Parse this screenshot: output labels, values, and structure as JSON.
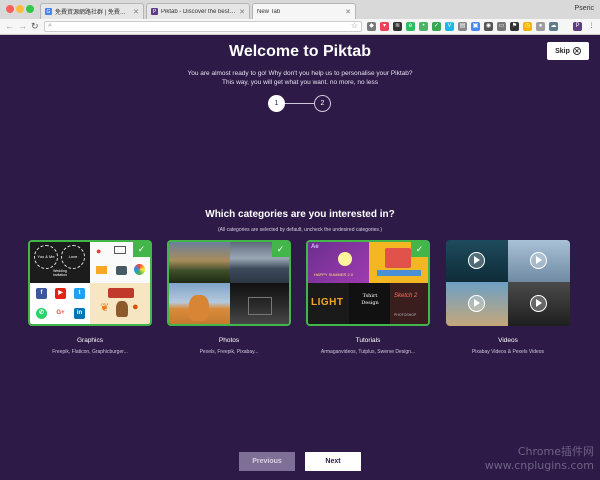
{
  "browser": {
    "tabs": [
      {
        "label": "免費資源網路社群 | 免費資源指",
        "favicon": "G",
        "active": false
      },
      {
        "label": "Piktab - Discover the best gra",
        "favicon": "P",
        "active": false
      },
      {
        "label": "New Tab",
        "favicon": "",
        "active": true
      }
    ],
    "user_name": "Pseric",
    "omnibox": {
      "value": "",
      "placeholder": ""
    },
    "extension_icons": [
      "shield-icon",
      "pocket-icon",
      "layers-icon",
      "evernote-icon",
      "pushbullet-icon",
      "check-icon",
      "vimeo-icon",
      "stack-icon",
      "puzzle-icon",
      "ghost-icon",
      "cast-icon",
      "flag-icon",
      "clock-icon",
      "globe-icon",
      "piktab-icon",
      "menu-icon"
    ]
  },
  "page": {
    "title": "Welcome to Piktab",
    "intro_line1": "You are almost ready to go! Why don't you help us to personalise your Piktab?",
    "intro_line2": "This way, you will get what you want. no more, no less",
    "skip_label": "Skip",
    "steps": [
      "1",
      "2"
    ],
    "question": "Which categories are you interested in?",
    "note": "(All categories are selected by default, uncheck the undesired categories.)",
    "categories": [
      {
        "title": "Graphics",
        "sources": "Freepik, Flaticon, Graphicburger...",
        "selected": true
      },
      {
        "title": "Photos",
        "sources": "Pexels, Freepik, Pixabay...",
        "selected": true
      },
      {
        "title": "Tutorials",
        "sources": "Armaganvideos, Tutplus, Swerve Design...",
        "selected": true
      },
      {
        "title": "Videos",
        "sources": "Pixabay Videos & Pexels Videos",
        "selected": false
      }
    ],
    "graphics_tile_texts": [
      "You & Me",
      "Love",
      "Wedding Invitation",
      "G+",
      "in"
    ],
    "tutorial_tile_texts": [
      "Ae",
      "HAPPY SUMMER 2.0",
      "LIGHT",
      "Tshirt Design",
      "Sketch 2",
      "PHOTOSHOP"
    ],
    "previous_label": "Previous",
    "next_label": "Next"
  },
  "watermark": {
    "line1": "Chrome插件网",
    "line2": "www.cnplugins.com"
  },
  "colors": {
    "background": "#2d1a47",
    "check_green": "#43b649",
    "previous_button": "#7d6f95"
  }
}
